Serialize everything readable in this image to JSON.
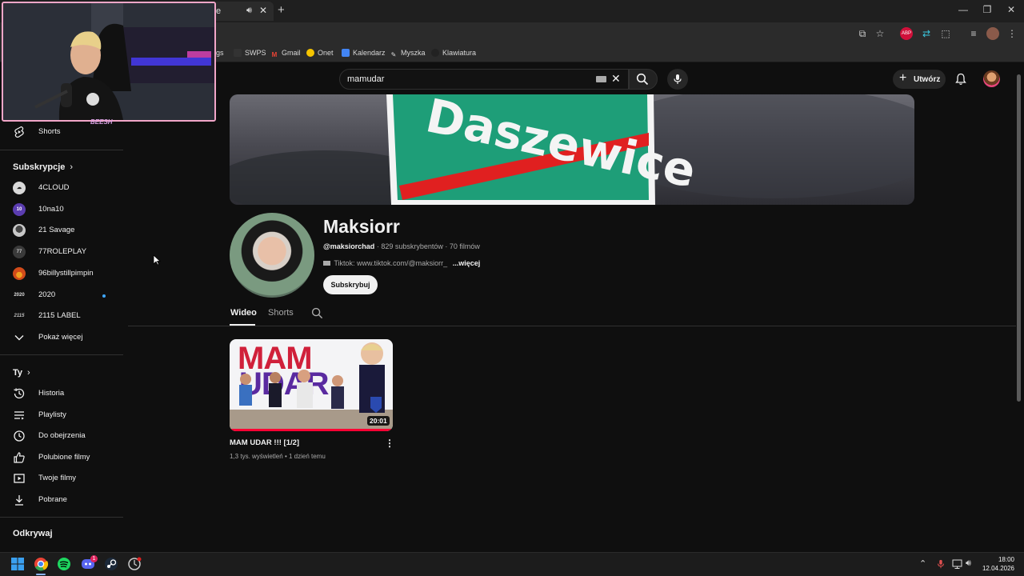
{
  "browser": {
    "tab_title": "e",
    "new_tab": "+",
    "bookmarks": [
      {
        "label": "gs"
      },
      {
        "label": "SWPS"
      },
      {
        "label": "Gmail"
      },
      {
        "label": "Onet"
      },
      {
        "label": "Kalendarz"
      },
      {
        "label": "Myszka"
      },
      {
        "label": "Klawiatura"
      }
    ]
  },
  "header": {
    "search_query": "mamudar",
    "create_label": "Utwórz"
  },
  "sidebar": {
    "shorts_label": "Shorts",
    "subscriptions_heading": "Subskrypcje",
    "subscriptions": [
      {
        "label": "4CLOUD",
        "color": "#d9d9d9"
      },
      {
        "label": "10na10",
        "color": "#5b3db0"
      },
      {
        "label": "21 Savage",
        "color": "#c8c8c8"
      },
      {
        "label": "77ROLEPLAY",
        "color": "#3a3a3a"
      },
      {
        "label": "96billystillpimpin",
        "color": "#d24b1a"
      },
      {
        "label": "2020",
        "color": "#0f0f0f"
      },
      {
        "label": "2115 LABEL",
        "color": "#0f0f0f"
      }
    ],
    "show_more": "Pokaż więcej",
    "you_heading": "Ty",
    "you_items": [
      {
        "label": "Historia",
        "icon": "history-icon"
      },
      {
        "label": "Playlisty",
        "icon": "playlist-icon"
      },
      {
        "label": "Do obejrzenia",
        "icon": "watch-later-icon"
      },
      {
        "label": "Polubione filmy",
        "icon": "like-icon"
      },
      {
        "label": "Twoje filmy",
        "icon": "your-videos-icon"
      },
      {
        "label": "Pobrane",
        "icon": "download-icon"
      }
    ],
    "explore_heading": "Odkrywaj"
  },
  "channel": {
    "banner_text": "Daszewice",
    "name": "Maksiorr",
    "handle": "@maksiorchad",
    "subscribers": "829 subskrybentów",
    "videos_count": "70 filmów",
    "description": "Tiktok: www.tiktok.com/@maksiorr_",
    "more": "...więcej",
    "subscribe_label": "Subskrybuj",
    "tabs": [
      "Wideo",
      "Shorts"
    ]
  },
  "videos": [
    {
      "title": "MAM UDAR !!! [1/2]",
      "views": "1,3 tys. wyświetleń",
      "age": "1 dzień temu",
      "duration": "20:01",
      "thumb_text_1": "MAM",
      "thumb_text_2": "UDAR"
    }
  ],
  "overlay": {
    "cam_tag": "BEESH"
  },
  "taskbar": {
    "time": "18:00",
    "date": "12.04.2026",
    "discord_badge": "1"
  }
}
